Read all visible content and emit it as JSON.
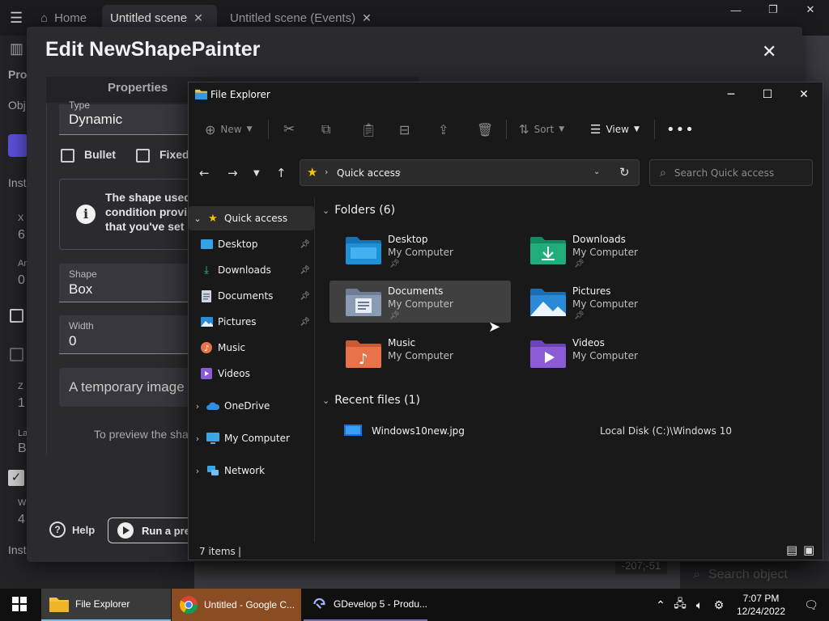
{
  "gdevelop": {
    "tabs": [
      {
        "label": "Home"
      },
      {
        "label": "Untitled scene"
      },
      {
        "label": "Untitled scene (Events)"
      }
    ],
    "side_labels": [
      "Pro",
      "Obj",
      "Inst",
      "X",
      "6",
      "An",
      "0",
      "Z",
      "1",
      "La",
      "B",
      "W",
      "4",
      "Inst"
    ],
    "coord": "-207;-51",
    "search_object_placeholder": "Search object"
  },
  "dialog": {
    "title": "Edit NewShapePainter",
    "tab": "Properties",
    "type_label": "Type",
    "type_value": "Dynamic",
    "bullet_label": "Bullet",
    "fixed_label": "Fixed",
    "info_lines": [
      "The shape used",
      "condition provi",
      "that you've set u"
    ],
    "shape_label": "Shape",
    "shape_value": "Box",
    "width_label": "Width",
    "width_value": "0",
    "temp_image_text": "A temporary image t",
    "preview_text": "To preview the sha",
    "help_label": "Help",
    "run_label": "Run a prev"
  },
  "explorer": {
    "title": "File Explorer",
    "toolbar": {
      "new_label": "New",
      "sort_label": "Sort",
      "view_label": "View"
    },
    "address": {
      "crumb": "Quick access"
    },
    "search_placeholder": "Search Quick access",
    "nav": [
      {
        "label": "Quick access",
        "icon": "star-icon",
        "level": 0,
        "expanded": true,
        "selected": true
      },
      {
        "label": "Desktop",
        "icon": "desktop-icon",
        "level": 1,
        "pinned": true
      },
      {
        "label": "Downloads",
        "icon": "download-icon",
        "level": 1,
        "pinned": true
      },
      {
        "label": "Documents",
        "icon": "documents-icon",
        "level": 1,
        "pinned": true
      },
      {
        "label": "Pictures",
        "icon": "pictures-icon",
        "level": 1,
        "pinned": true
      },
      {
        "label": "Music",
        "icon": "music-icon",
        "level": 1,
        "pinned": false
      },
      {
        "label": "Videos",
        "icon": "videos-icon",
        "level": 1,
        "pinned": false
      },
      {
        "label": "OneDrive",
        "icon": "cloud-icon",
        "level": 0,
        "expanded": false
      },
      {
        "label": "My Computer",
        "icon": "computer-icon",
        "level": 0,
        "expanded": false
      },
      {
        "label": "Network",
        "icon": "network-icon",
        "level": 0,
        "expanded": false
      }
    ],
    "folders_heading": "Folders (6)",
    "folders": [
      {
        "name": "Desktop",
        "location": "My Computer",
        "pinned": true,
        "color": "#1e90d8"
      },
      {
        "name": "Downloads",
        "location": "My Computer",
        "pinned": true,
        "color": "#1fae7a"
      },
      {
        "name": "Documents",
        "location": "My Computer",
        "pinned": true,
        "color": "#8a9bb5",
        "selected": true
      },
      {
        "name": "Pictures",
        "location": "My Computer",
        "pinned": true,
        "color": "#2a8ad8"
      },
      {
        "name": "Music",
        "location": "My Computer",
        "pinned": false,
        "color": "#e8734a"
      },
      {
        "name": "Videos",
        "location": "My Computer",
        "pinned": false,
        "color": "#8b5cd6"
      }
    ],
    "recent_heading": "Recent files (1)",
    "recent": [
      {
        "name": "Windows10new.jpg",
        "location": "Local Disk (C:)\\Windows 10"
      }
    ],
    "status": "7 items"
  },
  "taskbar": {
    "items": [
      {
        "label": "File Explorer",
        "icon": "folder-icon",
        "active": true
      },
      {
        "label": "Untitled - Google C...",
        "icon": "chrome-icon"
      },
      {
        "label": "GDevelop 5 - Produ...",
        "icon": "gdevelop-icon"
      }
    ],
    "time": "7:07 PM",
    "date": "12/24/2022"
  },
  "colors": {
    "accent": "#76b9ed",
    "star": "#f5c400"
  }
}
